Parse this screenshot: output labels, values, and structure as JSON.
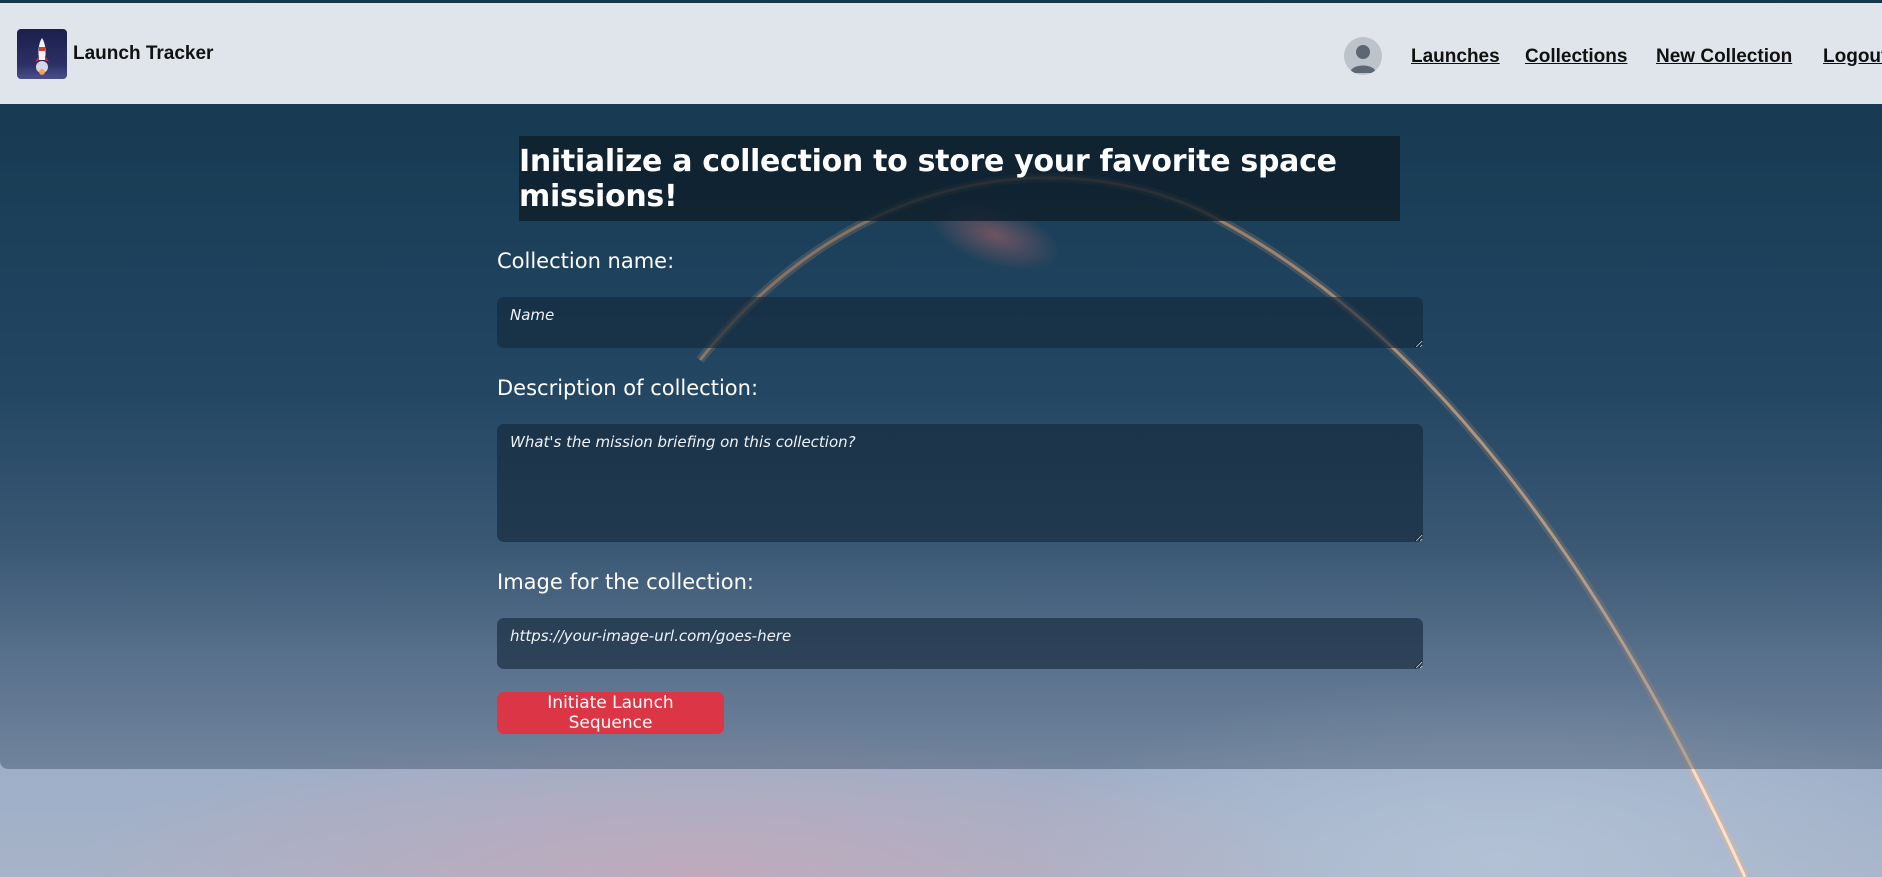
{
  "brand": {
    "name": "Launch Tracker",
    "logo_icon": "rocket-icon"
  },
  "nav": {
    "avatar_icon": "user-avatar-icon",
    "links": [
      {
        "label": "Launches"
      },
      {
        "label": "Collections"
      },
      {
        "label": "New Collection"
      },
      {
        "label": "Logout"
      }
    ]
  },
  "form": {
    "heading": "Initialize a collection to store your favorite space missions!",
    "name_label": "Collection name:",
    "name_placeholder": "Name",
    "description_label": "Description of collection:",
    "description_placeholder": "What's the mission briefing on this collection?",
    "image_label": "Image for the collection:",
    "image_placeholder": "https://your-image-url.com/goes-here",
    "submit_label": "Initiate Launch Sequence"
  },
  "colors": {
    "navbar_bg": "#dfe5ea",
    "button_bg": "#dc3545",
    "heading_bg": "#0d1c28"
  }
}
